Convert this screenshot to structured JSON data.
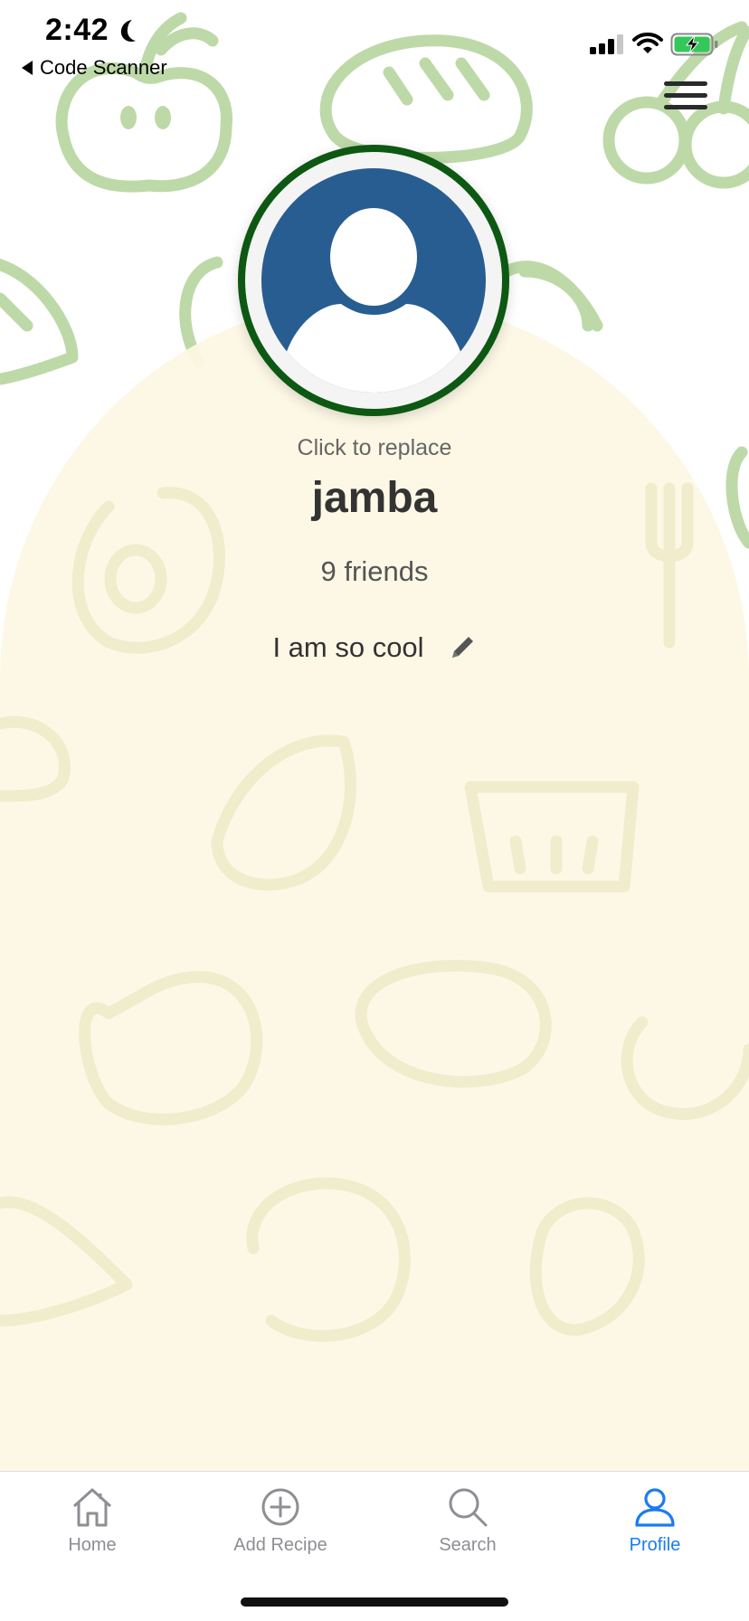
{
  "status_bar": {
    "time": "2:42",
    "back_label": "Code Scanner"
  },
  "profile": {
    "replace_hint": "Click to replace",
    "username": "jamba",
    "friends": "9 friends",
    "bio": "I am so cool"
  },
  "tab_bar": {
    "tabs": [
      {
        "label": "Home",
        "icon": "home-icon",
        "active": false
      },
      {
        "label": "Add Recipe",
        "icon": "plus-circle-icon",
        "active": false
      },
      {
        "label": "Search",
        "icon": "search-icon",
        "active": false
      },
      {
        "label": "Profile",
        "icon": "person-icon",
        "active": true
      }
    ]
  },
  "colors": {
    "avatar_ring": "#0d5812",
    "avatar_fill": "#285d91",
    "active_tab": "#1a7cf0",
    "inactive_tab": "#8e8e93",
    "cream": "#fdf8e4",
    "doodle_green": "#bdd9a8"
  }
}
